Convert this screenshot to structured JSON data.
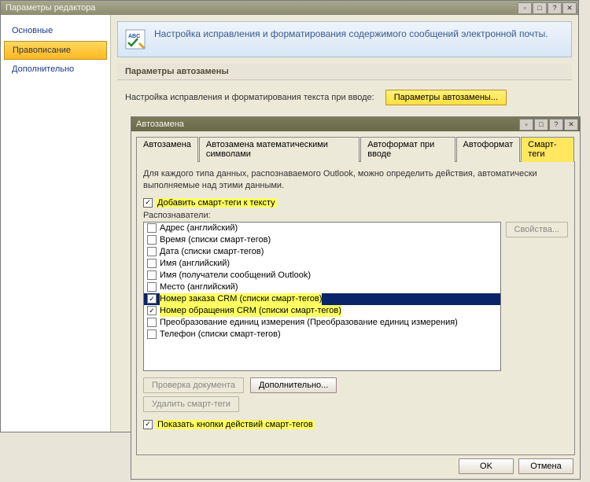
{
  "main_window": {
    "title": "Параметры редактора",
    "sidebar": {
      "items": [
        {
          "label": "Основные"
        },
        {
          "label": "Правописание"
        },
        {
          "label": "Дополнительно"
        }
      ]
    },
    "banner": {
      "heading": "Настройка исправления и форматирования содержимого сообщений электронной почты."
    },
    "section_header": "Параметры автозамены",
    "params_row": {
      "text": "Настройка исправления и форматирования текста при вводе:",
      "button": "Параметры автозамены..."
    }
  },
  "dialog": {
    "title": "Автозамена",
    "tabs": [
      {
        "label": "Автозамена"
      },
      {
        "label": "Автозамена математическими символами"
      },
      {
        "label": "Автоформат при вводе"
      },
      {
        "label": "Автоформат"
      },
      {
        "label": "Смарт-теги"
      }
    ],
    "description": "Для каждого типа данных, распознаваемого Outlook, можно определить действия, автоматически выполняемые над этими данными.",
    "add_smart_tags_label": "Добавить смарт-теги к тексту",
    "recognizers_label": "Распознаватели:",
    "properties_button": "Свойства...",
    "recognizers": [
      {
        "label": "Адрес (английский)",
        "checked": false
      },
      {
        "label": "Время (списки смарт-тегов)",
        "checked": false
      },
      {
        "label": "Дата (списки смарт-тегов)",
        "checked": false
      },
      {
        "label": "Имя (английский)",
        "checked": false
      },
      {
        "label": "Имя (получатели сообщений Outlook)",
        "checked": false
      },
      {
        "label": "Место (английский)",
        "checked": false
      },
      {
        "label": "Номер заказа CRM (списки смарт-тегов)",
        "checked": true,
        "selected": true
      },
      {
        "label": "Номер обращения CRM (списки смарт-тегов)",
        "checked": true,
        "hl": true
      },
      {
        "label": "Преобразование единиц измерения (Преобразование единиц измерения)",
        "checked": false
      },
      {
        "label": "Телефон (списки смарт-тегов)",
        "checked": false
      }
    ],
    "buttons": {
      "check_doc": "Проверка документа",
      "more": "Дополнительно...",
      "delete_tags": "Удалить смарт-теги"
    },
    "show_actions_label": "Показать кнопки действий смарт-тегов",
    "ok": "OK",
    "cancel": "Отмена"
  }
}
